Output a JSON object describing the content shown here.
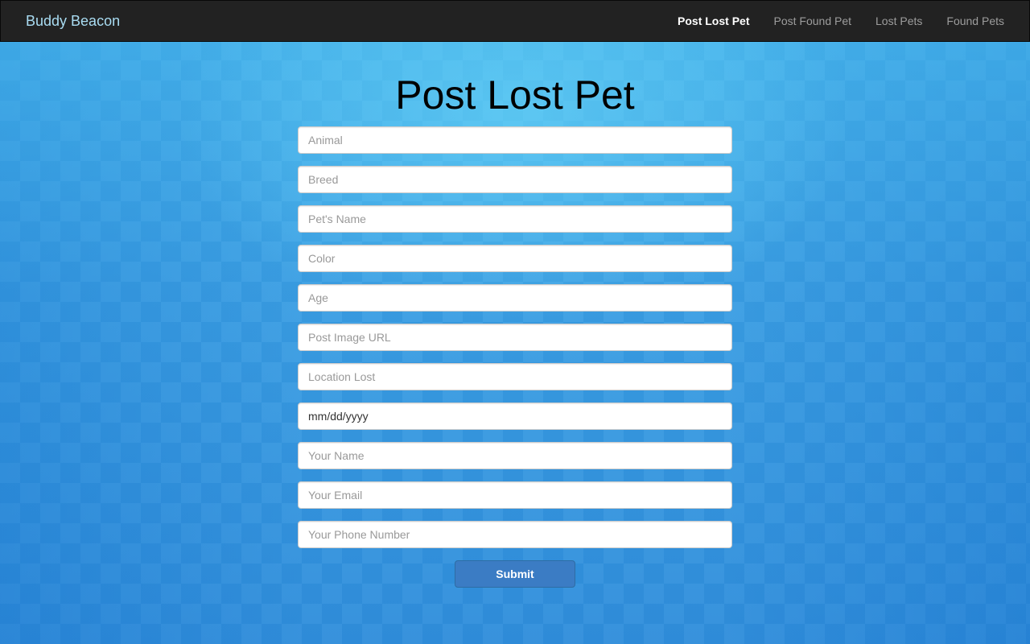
{
  "navbar": {
    "brand": "Buddy Beacon",
    "links": [
      {
        "label": "Post Lost Pet",
        "active": true
      },
      {
        "label": "Post Found Pet",
        "active": false
      },
      {
        "label": "Lost Pets",
        "active": false
      },
      {
        "label": "Found Pets",
        "active": false
      }
    ]
  },
  "page": {
    "title": "Post Lost Pet"
  },
  "form": {
    "fields": {
      "animal": {
        "placeholder": "Animal",
        "value": ""
      },
      "breed": {
        "placeholder": "Breed",
        "value": ""
      },
      "pet_name": {
        "placeholder": "Pet's Name",
        "value": ""
      },
      "color": {
        "placeholder": "Color",
        "value": ""
      },
      "age": {
        "placeholder": "Age",
        "value": ""
      },
      "image_url": {
        "placeholder": "Post Image URL",
        "value": ""
      },
      "location_lost": {
        "placeholder": "Location Lost",
        "value": ""
      },
      "date_lost": {
        "display": "mm/dd/yyyy"
      },
      "your_name": {
        "placeholder": "Your Name",
        "value": ""
      },
      "your_email": {
        "placeholder": "Your Email",
        "value": ""
      },
      "your_phone": {
        "placeholder": "Your Phone Number",
        "value": ""
      }
    },
    "submit_label": "Submit"
  },
  "colors": {
    "navbar_background": "#222222",
    "brand": "#a9dcf2",
    "nav_inactive": "#9d9d9d",
    "nav_active": "#ffffff",
    "page_background": "#3a9be0",
    "submit_button": "#3b7cc4"
  }
}
